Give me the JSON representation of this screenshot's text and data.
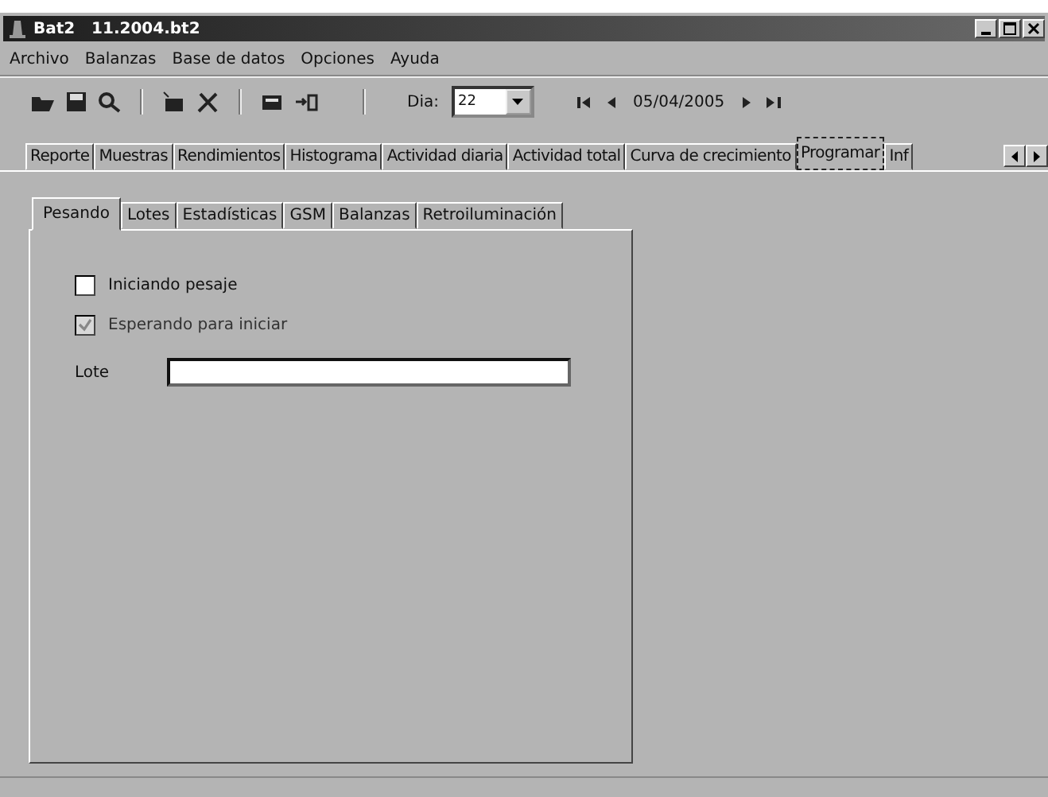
{
  "window": {
    "title": "Bat2   11.2004.bt2"
  },
  "menu": [
    "Archivo",
    "Balanzas",
    "Base de datos",
    "Opciones",
    "Ayuda"
  ],
  "toolbar": {
    "day_label": "Dia:",
    "day_value": "22",
    "date": "05/04/2005"
  },
  "tabs": [
    {
      "label": "Reporte",
      "selected": false
    },
    {
      "label": "Muestras",
      "selected": false
    },
    {
      "label": "Rendimientos",
      "selected": false
    },
    {
      "label": "Histograma",
      "selected": false
    },
    {
      "label": "Actividad diaria",
      "selected": false
    },
    {
      "label": "Actividad total",
      "selected": false
    },
    {
      "label": "Curva de crecimiento",
      "selected": false
    },
    {
      "label": "Programar",
      "selected": true
    },
    {
      "label": "Inf",
      "selected": false
    }
  ],
  "subtabs": [
    {
      "label": "Pesando",
      "selected": true
    },
    {
      "label": "Lotes",
      "selected": false
    },
    {
      "label": "Estadísticas",
      "selected": false
    },
    {
      "label": "GSM",
      "selected": false
    },
    {
      "label": "Balanzas",
      "selected": false
    },
    {
      "label": "Retroiluminación",
      "selected": false
    }
  ],
  "options": [
    {
      "label": "Iniciando pesaje",
      "checked": false,
      "disabled": false
    },
    {
      "label": "Esperando para iniciar",
      "checked": true,
      "disabled": true
    }
  ],
  "lot": {
    "label": "Lote"
  }
}
